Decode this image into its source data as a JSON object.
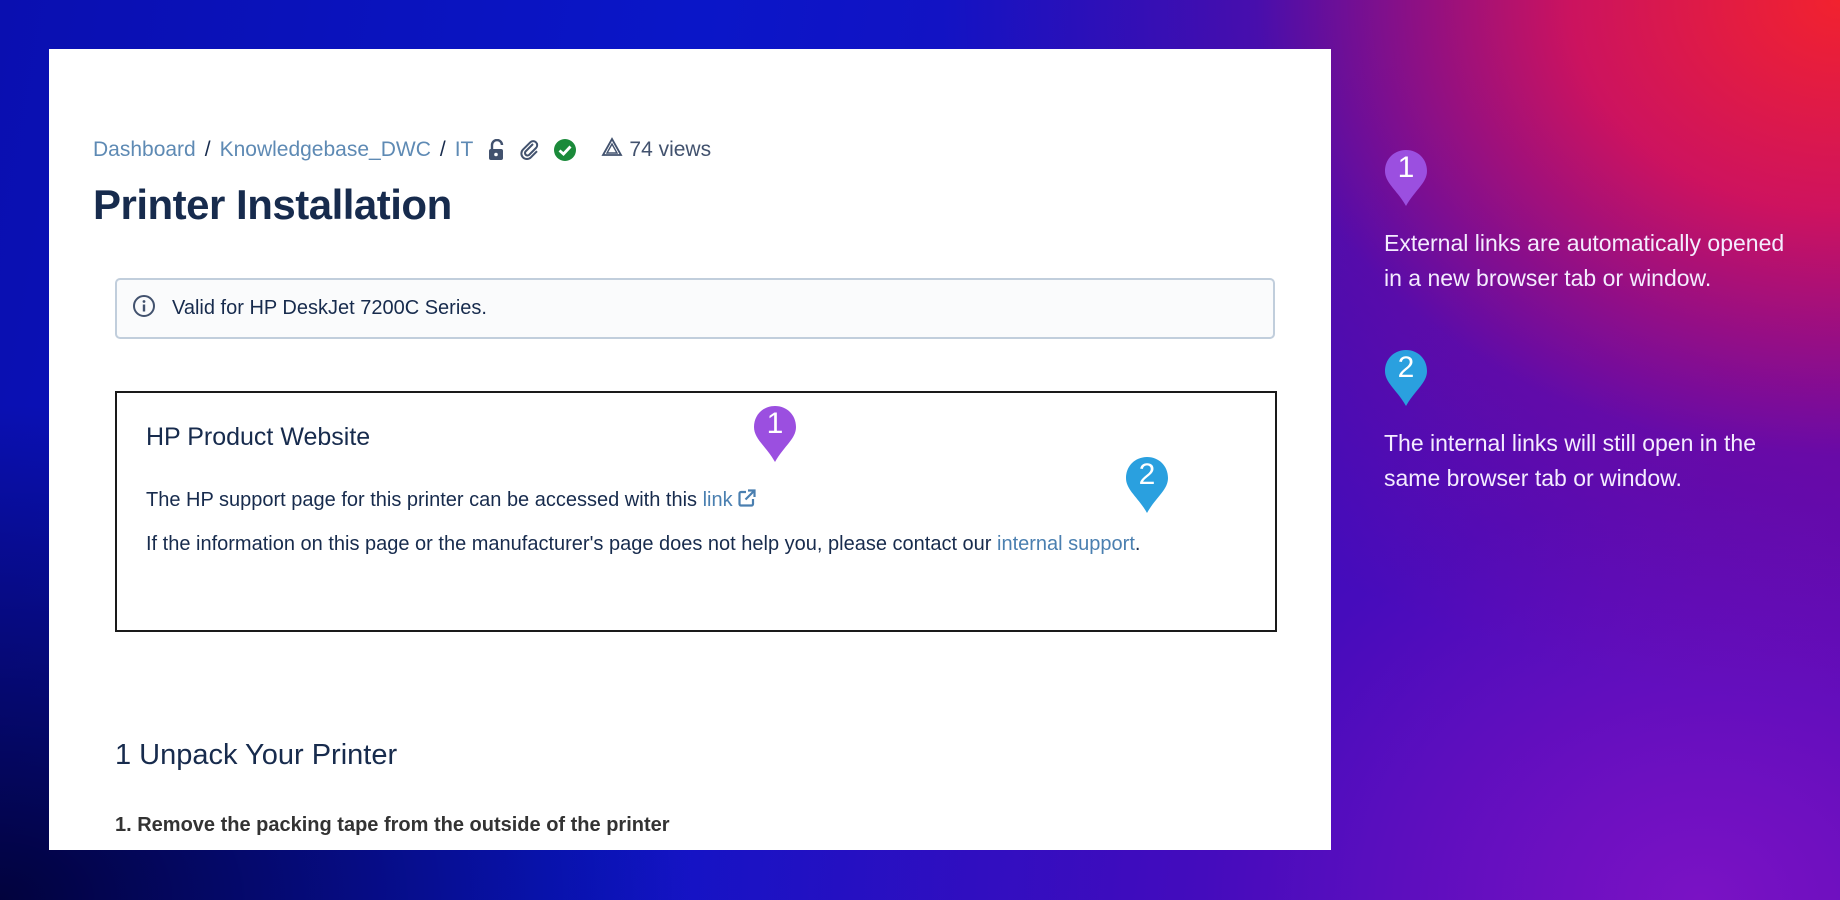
{
  "breadcrumb": {
    "items": [
      "Dashboard",
      "Knowledgebase_DWC",
      "IT"
    ],
    "separator": "/",
    "views": "74 views"
  },
  "page": {
    "title": "Printer Installation"
  },
  "info_panel": {
    "text": "Valid for HP DeskJet 7200C Series."
  },
  "product_box": {
    "heading": "HP Product Website",
    "line1_text": "The HP support page for this printer can be accessed with this ",
    "line1_link": "link",
    "line2_text": "If the information on this page or the manufacturer's page does not help you, please contact our ",
    "line2_link": "internal support",
    "line2_end": "."
  },
  "section": {
    "heading": "1 Unpack Your Printer",
    "step": "1. Remove the packing tape from the outside of the printer"
  },
  "markers": [
    {
      "number": "1",
      "color": "#9b4fe0"
    },
    {
      "number": "2",
      "color": "#2aa0df"
    }
  ],
  "callouts": [
    {
      "number": "1",
      "text": "External links are automatically opened in a new browser tab or window."
    },
    {
      "number": "2",
      "text": "The internal links will still open in the same browser tab or window."
    }
  ],
  "icons": [
    "lock-open-icon",
    "paperclip-icon",
    "check-circle-icon",
    "views-icon",
    "info-icon",
    "external-link-icon"
  ],
  "colors": {
    "link": "#4a7fb0",
    "title": "#172b4d",
    "check": "#1b8a3a",
    "marker_purple": "#9b4fe0",
    "marker_blue": "#2aa0df"
  }
}
